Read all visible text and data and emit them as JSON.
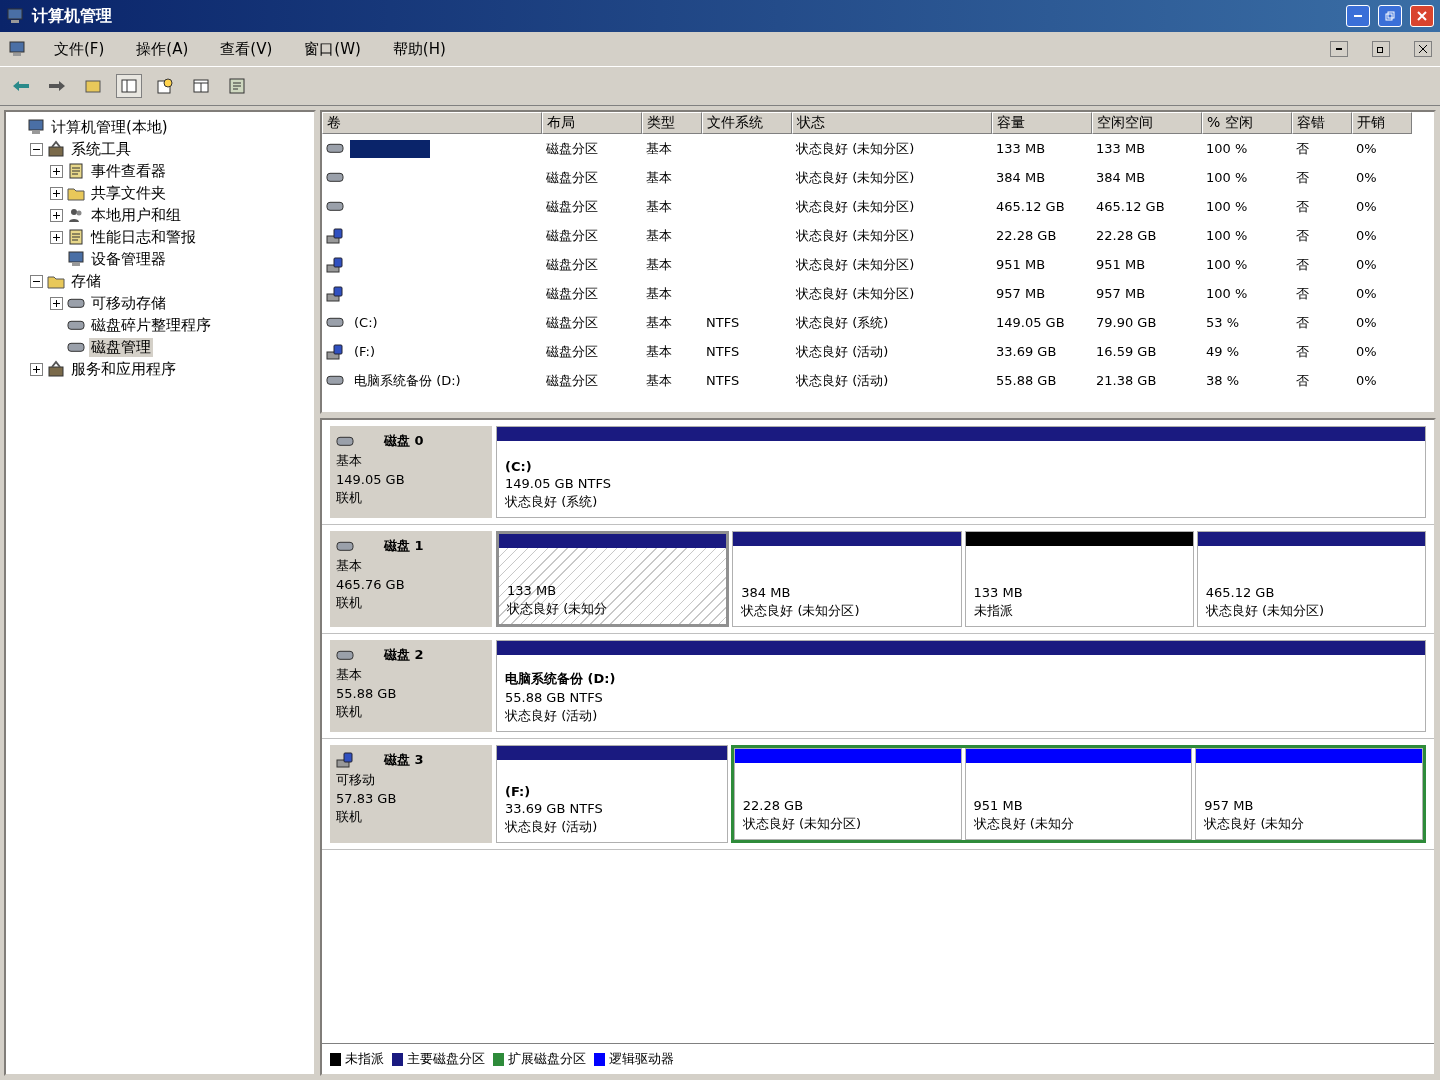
{
  "window": {
    "title": "计算机管理"
  },
  "menu": [
    "文件(F)",
    "操作(A)",
    "查看(V)",
    "窗口(W)",
    "帮助(H)"
  ],
  "tree": [
    {
      "label": "计算机管理(本地)",
      "selected": false,
      "children": [
        {
          "label": "系统工具",
          "expanded": true,
          "selected": false,
          "children": [
            {
              "label": "事件查看器",
              "expanded": false,
              "selected": false
            },
            {
              "label": "共享文件夹",
              "expanded": false,
              "selected": false
            },
            {
              "label": "本地用户和组",
              "expanded": false,
              "selected": false
            },
            {
              "label": "性能日志和警报",
              "expanded": false,
              "selected": false
            },
            {
              "label": "设备管理器",
              "selected": false
            }
          ]
        },
        {
          "label": "存储",
          "expanded": true,
          "selected": false,
          "children": [
            {
              "label": "可移动存储",
              "expanded": false,
              "selected": false
            },
            {
              "label": "磁盘碎片整理程序",
              "selected": false
            },
            {
              "label": "磁盘管理",
              "selected": true
            }
          ]
        },
        {
          "label": "服务和应用程序",
          "expanded": false,
          "selected": false
        }
      ]
    }
  ],
  "table": {
    "columns": [
      "卷",
      "布局",
      "类型",
      "文件系统",
      "状态",
      "容量",
      "空闲空间",
      "% 空闲",
      "容错",
      "开销"
    ],
    "rows": [
      {
        "kind": "disk",
        "selected": true,
        "layout": "磁盘分区",
        "type": "基本",
        "status": "状态良好 (未知分区)",
        "capacity": "133 MB",
        "free": "133 MB",
        "pct": "100 %",
        "fault": "否",
        "overhead": "0%"
      },
      {
        "kind": "disk",
        "selected": false,
        "layout": "磁盘分区",
        "type": "基本",
        "status": "状态良好 (未知分区)",
        "capacity": "384 MB",
        "free": "384 MB",
        "pct": "100 %",
        "fault": "否",
        "overhead": "0%"
      },
      {
        "kind": "disk",
        "selected": false,
        "layout": "磁盘分区",
        "type": "基本",
        "status": "状态良好 (未知分区)",
        "capacity": "465.12 GB",
        "free": "465.12 GB",
        "pct": "100 %",
        "fault": "否",
        "overhead": "0%"
      },
      {
        "kind": "removable",
        "selected": false,
        "layout": "磁盘分区",
        "type": "基本",
        "status": "状态良好 (未知分区)",
        "capacity": "22.28 GB",
        "free": "22.28 GB",
        "pct": "100 %",
        "fault": "否",
        "overhead": "0%"
      },
      {
        "kind": "removable",
        "selected": false,
        "layout": "磁盘分区",
        "type": "基本",
        "status": "状态良好 (未知分区)",
        "capacity": "951 MB",
        "free": "951 MB",
        "pct": "100 %",
        "fault": "否",
        "overhead": "0%"
      },
      {
        "kind": "removable",
        "selected": false,
        "layout": "磁盘分区",
        "type": "基本",
        "status": "状态良好 (未知分区)",
        "capacity": "957 MB",
        "free": "957 MB",
        "pct": "100 %",
        "fault": "否",
        "overhead": "0%"
      },
      {
        "kind": "disk",
        "selected": false,
        "volume": "(C:)",
        "layout": "磁盘分区",
        "type": "基本",
        "fs": "NTFS",
        "status": "状态良好 (系统)",
        "capacity": "149.05 GB",
        "free": "79.90 GB",
        "pct": "53 %",
        "fault": "否",
        "overhead": "0%"
      },
      {
        "kind": "removable",
        "selected": false,
        "volume": "(F:)",
        "layout": "磁盘分区",
        "type": "基本",
        "fs": "NTFS",
        "status": "状态良好 (活动)",
        "capacity": "33.69 GB",
        "free": "16.59 GB",
        "pct": "49 %",
        "fault": "否",
        "overhead": "0%"
      },
      {
        "kind": "disk",
        "selected": false,
        "volume": "电脑系统备份 (D:)",
        "layout": "磁盘分区",
        "type": "基本",
        "fs": "NTFS",
        "status": "状态良好 (活动)",
        "capacity": "55.88 GB",
        "free": "21.38 GB",
        "pct": "38 %",
        "fault": "否",
        "overhead": "0%"
      }
    ]
  },
  "disks": [
    {
      "name": "磁盘 0",
      "kind": "disk",
      "type": "基本",
      "size": "149.05 GB",
      "state": "联机",
      "partitions": [
        {
          "kind": "primary",
          "selected": false,
          "name": "(C:)",
          "size": "149.05 GB NTFS",
          "status": "状态良好 (系统)"
        }
      ]
    },
    {
      "name": "磁盘 1",
      "kind": "disk",
      "type": "基本",
      "size": "465.76 GB",
      "state": "联机",
      "partitions": [
        {
          "kind": "primary",
          "selected": true,
          "size": "133 MB",
          "status": "状态良好 (未知分"
        },
        {
          "kind": "primary",
          "selected": false,
          "size": "384 MB",
          "status": "状态良好 (未知分区)"
        },
        {
          "kind": "unallocated",
          "selected": false,
          "size": "133 MB",
          "status": "未指派"
        },
        {
          "kind": "primary",
          "selected": false,
          "size": "465.12 GB",
          "status": "状态良好 (未知分区)"
        }
      ]
    },
    {
      "name": "磁盘 2",
      "kind": "disk",
      "type": "基本",
      "size": "55.88 GB",
      "state": "联机",
      "partitions": [
        {
          "kind": "primary",
          "selected": false,
          "name": "电脑系统备份 (D:)",
          "size": "55.88 GB NTFS",
          "status": "状态良好 (活动)"
        }
      ]
    },
    {
      "name": "磁盘 3",
      "kind": "removable",
      "type": "可移动",
      "size": "57.83 GB",
      "state": "联机",
      "partitions": [
        {
          "kind": "primary",
          "selected": false,
          "name": "(F:)",
          "size": "33.69 GB NTFS",
          "status": "状态良好 (活动)"
        },
        {
          "kind": "extended",
          "children": [
            {
              "kind": "logical",
              "selected": false,
              "size": "22.28 GB",
              "status": "状态良好 (未知分区)"
            },
            {
              "kind": "logical",
              "selected": false,
              "size": "951 MB",
              "status": "状态良好 (未知分"
            },
            {
              "kind": "logical",
              "selected": false,
              "size": "957 MB",
              "status": "状态良好 (未知分"
            }
          ]
        }
      ]
    }
  ],
  "legend": [
    {
      "label": "未指派",
      "color": "#000000"
    },
    {
      "label": "主要磁盘分区",
      "color": "#1a1a80"
    },
    {
      "label": "扩展磁盘分区",
      "color": "#2e8b3a"
    },
    {
      "label": "逻辑驱动器",
      "color": "#0000ff"
    }
  ]
}
